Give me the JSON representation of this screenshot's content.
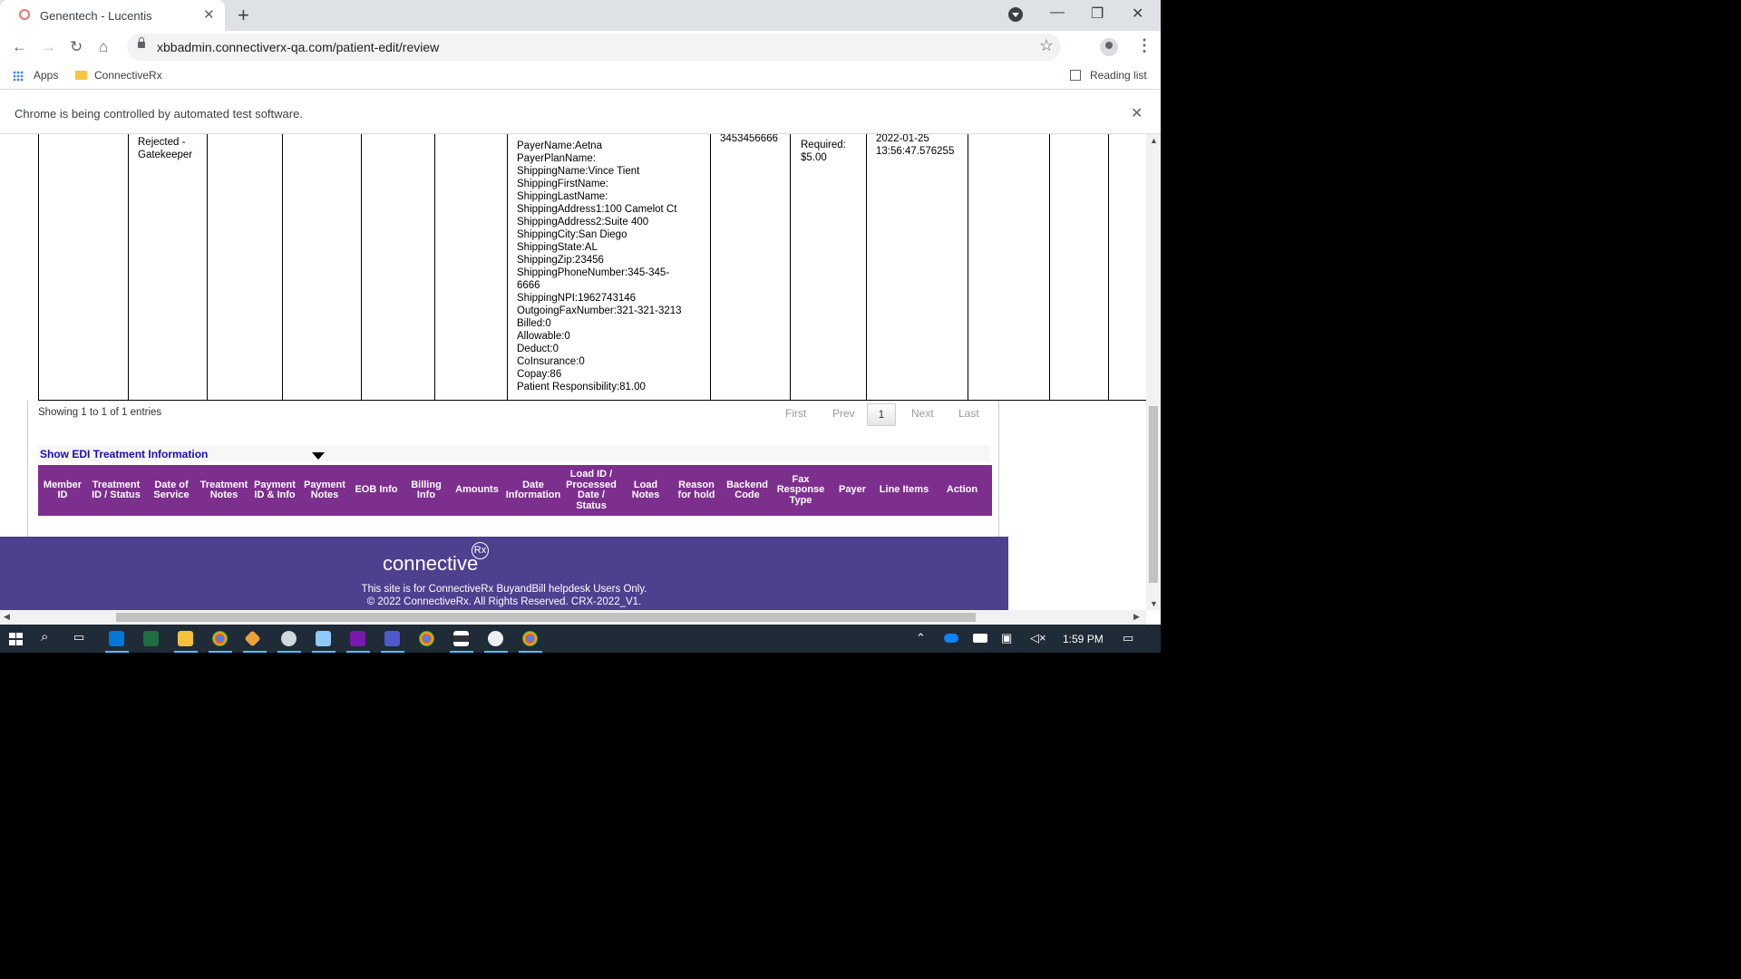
{
  "browser": {
    "tab_title": "Genentech - Lucentis",
    "new_tab": "+",
    "url": "xbbadmin.connectiverx-qa.com/patient-edit/review",
    "bookmarks": [
      {
        "label": "Apps",
        "icon": "apps-grid-icon"
      },
      {
        "label": "ConnectiveRx",
        "icon": "folder-icon"
      }
    ],
    "reading_list": "Reading list",
    "infobar_text": "Chrome is being controlled by automated test software.",
    "window_controls": {
      "minimize": "—",
      "restore": "❐",
      "close": "✕"
    }
  },
  "table_fragment": {
    "status": [
      "Rejected -",
      "Gatekeeper"
    ],
    "phone": "3453456666",
    "required_label": "Required:",
    "amount": "$5.00",
    "timestamp": [
      "2022-01-25",
      "13:56:47.576255"
    ],
    "details": [
      "PayerName:Aetna",
      "PayerPlanName:",
      "ShippingName:Vince Tient",
      "ShippingFirstName:",
      "ShippingLastName:",
      "ShippingAddress1:100 Camelot Ct",
      "ShippingAddress2:Suite 400",
      "ShippingCity:San Diego",
      "ShippingState:AL",
      "ShippingZip:23456",
      "ShippingPhoneNumber:345-345-",
      "6666",
      "ShippingNPI:1962743146",
      "OutgoingFaxNumber:321-321-3213",
      "Billed:0",
      "Allowable:0",
      "Deduct:0",
      "CoInsurance:0",
      "Copay:86",
      "Patient Responsibility:81.00"
    ]
  },
  "pagination": {
    "showing": "Showing 1 to 1 of 1 entries",
    "first": "First",
    "prev": "Prev",
    "current": "1",
    "next": "Next",
    "last": "Last"
  },
  "edi": {
    "toggle_label": "Show EDI Treatment Information",
    "columns": [
      "Member ID",
      "Treatment ID / Status",
      "Date of Service",
      "Treatment Notes",
      "Payment ID & Info",
      "Payment Notes",
      "EOB Info",
      "Billing Info",
      "Amounts",
      "Date Information",
      "Load ID / Processed Date / Status",
      "Load Notes",
      "Reason for hold",
      "Backend Code",
      "Fax Response Type",
      "Payer",
      "Line Items",
      "Action"
    ],
    "header_color": "#7d2f8e"
  },
  "footer": {
    "logo_text": "connective",
    "logo_mark": "Rx",
    "line1": "This site is for ConnectiveRx BuyandBill helpdesk Users Only.",
    "line2": "© 2022 ConnectiveRx. All Rights Reserved. CRX-2022_V1.",
    "color": "#4f3f8f"
  },
  "taskbar": {
    "clock": "1:59 PM",
    "icons": [
      "start-icon",
      "search-icon",
      "task-view-icon",
      "outlook-icon",
      "excel-icon",
      "file-explorer-icon",
      "chrome-icon",
      "app-icon",
      "app-icon",
      "app-icon",
      "onenote-icon",
      "teams-icon",
      "chrome-icon",
      "app-icon",
      "app-icon",
      "chrome-icon"
    ]
  }
}
